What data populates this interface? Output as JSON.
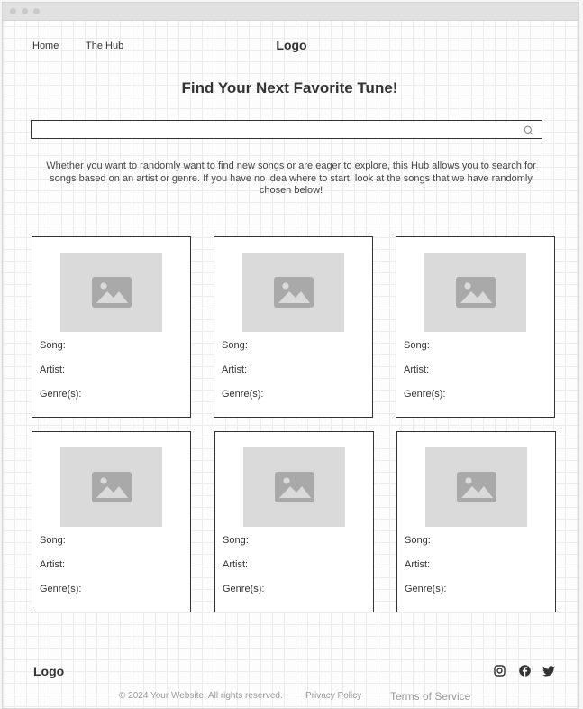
{
  "header": {
    "nav": [
      "Home",
      "The Hub"
    ],
    "logo": "Logo"
  },
  "main": {
    "heading": "Find Your Next Favorite Tune!",
    "search": {
      "value": "",
      "placeholder": ""
    },
    "intro": "Whether you want to randomly want to find new songs or are eager to explore, this Hub allows you to search for songs based on an artist or genre. If you have no idea where to start, look at the songs that we have randomly chosen below!",
    "cards": [
      {
        "song_label": "Song:",
        "artist_label": "Artist:",
        "genre_label": "Genre(s):"
      },
      {
        "song_label": "Song:",
        "artist_label": "Artist:",
        "genre_label": "Genre(s):"
      },
      {
        "song_label": "Song:",
        "artist_label": "Artist:",
        "genre_label": "Genre(s):"
      },
      {
        "song_label": "Song:",
        "artist_label": "Artist:",
        "genre_label": "Genre(s):"
      },
      {
        "song_label": "Song:",
        "artist_label": "Artist:",
        "genre_label": "Genre(s):"
      },
      {
        "song_label": "Song:",
        "artist_label": "Artist:",
        "genre_label": "Genre(s):"
      }
    ]
  },
  "footer": {
    "logo": "Logo",
    "social_icons": [
      "instagram-icon",
      "facebook-icon",
      "twitter-icon"
    ],
    "copyright": "© 2024 Your Website. All rights reserved.",
    "privacy": "Privacy Policy",
    "terms": "Terms of Service"
  },
  "colors": {
    "placeholder_bg": "#dadada",
    "placeholder_icon": "#a9a9a9",
    "border": "#333333",
    "muted_text": "#999999"
  }
}
